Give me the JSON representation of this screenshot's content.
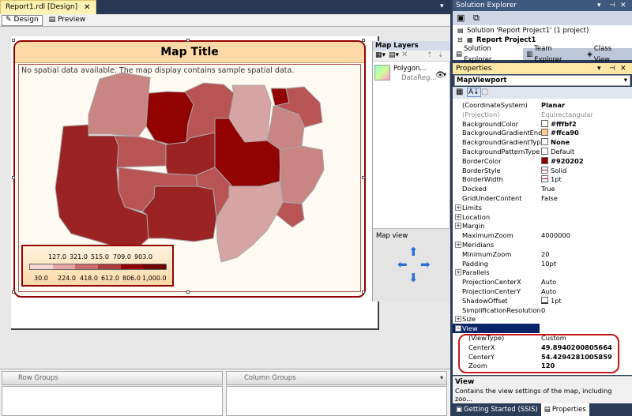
{
  "document": {
    "tab_title": "Report1.rdl [Design]",
    "designer_tabs": [
      "Design",
      "Preview"
    ]
  },
  "map": {
    "title": "Map Title",
    "no_spatial_message": "No spatial data available. The map display contains sample spatial data.",
    "legend": {
      "top_labels": [
        "127.0",
        "321.0",
        "515.0",
        "709.0",
        "903.0"
      ],
      "bottom_labels": [
        "30.0",
        "224.0",
        "418.0",
        "612.0",
        "806.0",
        "1,000.0"
      ],
      "colors": [
        "#f4d6d6",
        "#e6a5a5",
        "#c86c6c",
        "#ac3e3e",
        "#920202",
        "#6e0000"
      ]
    },
    "region_colors": {
      "darkest": "#920202",
      "dark": "#9b2323",
      "medium": "#b85454",
      "light": "#c98484",
      "lightest": "#d7a4a4"
    }
  },
  "map_layers": {
    "title": "Map Layers",
    "layer_name": "Polygon...",
    "layer_type": "DataReg...",
    "map_view_label": "Map view"
  },
  "groups": {
    "row_label": "Row Groups",
    "column_label": "Column Groups"
  },
  "solution_explorer": {
    "title": "Solution Explorer",
    "solution_text": "Solution 'Report Project1' (1 project)",
    "project_text": "Report Project1",
    "tabs": [
      "Solution Explorer",
      "Team Explorer",
      "Class View"
    ]
  },
  "properties": {
    "title": "Properties",
    "object": "MapViewport",
    "rows": [
      {
        "name": "(CoordinateSystem)",
        "value": "Planar",
        "bold": true
      },
      {
        "name": "(Projection)",
        "value": "Equirectangular",
        "grey": true
      },
      {
        "name": "BackgroundColor",
        "value": "#fffbf2",
        "swatch": "#fffbf2",
        "bold": true
      },
      {
        "name": "BackgroundGradientEndC",
        "value": "#ffca90",
        "swatch": "#ffca90",
        "bold": true
      },
      {
        "name": "BackgroundGradientType",
        "value": "None",
        "swatch": "#ffffff",
        "bold": true
      },
      {
        "name": "BackgroundPatternType",
        "value": "Default",
        "swatch": "#ffffff"
      },
      {
        "name": "BorderColor",
        "value": "#920202",
        "swatch": "#920202",
        "bold": true
      },
      {
        "name": "BorderStyle",
        "value": "Solid",
        "swatch": "line"
      },
      {
        "name": "BorderWidth",
        "value": "1pt",
        "swatch": "line"
      },
      {
        "name": "Docked",
        "value": "True"
      },
      {
        "name": "GridUnderContent",
        "value": "False"
      },
      {
        "name": "Limits",
        "value": "",
        "expand": true
      },
      {
        "name": "Location",
        "value": "",
        "expand": true
      },
      {
        "name": "Margin",
        "value": "",
        "expand": true
      },
      {
        "name": "MaximumZoom",
        "value": "4000000"
      },
      {
        "name": "Meridians",
        "value": "",
        "expand": true
      },
      {
        "name": "MinimumZoom",
        "value": "20"
      },
      {
        "name": "Padding",
        "value": "10pt"
      },
      {
        "name": "Parallels",
        "value": "",
        "expand": true
      },
      {
        "name": "ProjectionCenterX",
        "value": "Auto"
      },
      {
        "name": "ProjectionCenterY",
        "value": "Auto"
      },
      {
        "name": "ShadowOffset",
        "value": "1pt",
        "swatch": "box"
      },
      {
        "name": "SimplificationResolution",
        "value": "0"
      },
      {
        "name": "Size",
        "value": "",
        "expand": true
      },
      {
        "name": "View",
        "value": "",
        "expand": true,
        "selected": true
      },
      {
        "name": "(ViewType)",
        "value": "Custom",
        "sub": true
      },
      {
        "name": "CenterX",
        "value": "49.8940200805664",
        "sub": true,
        "bold": true
      },
      {
        "name": "CenterY",
        "value": "54.4294281005859",
        "sub": true,
        "bold": true
      },
      {
        "name": "Zoom",
        "value": "120",
        "sub": true,
        "bold": true
      }
    ],
    "desc_title": "View",
    "desc_text": "Contains the view settings of the map, including zoo..."
  },
  "bottom_tabs": [
    "Getting Started (SSIS)",
    "Properties"
  ]
}
